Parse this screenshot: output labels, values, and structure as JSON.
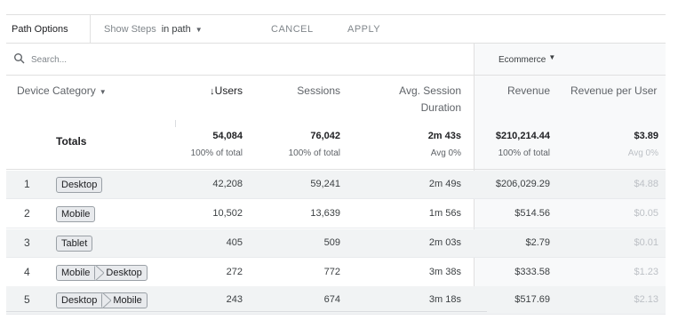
{
  "toolbar": {
    "path_options": "Path Options",
    "show_steps_label": "Show Steps",
    "show_steps_value": "in path",
    "cancel": "CANCEL",
    "apply": "APPLY"
  },
  "search": {
    "placeholder": "Search..."
  },
  "segment": {
    "label": "Ecommerce"
  },
  "columns": {
    "dimension": "Device Category",
    "users": "Users",
    "sessions": "Sessions",
    "duration_l1": "Avg. Session",
    "duration_l2": "Duration",
    "revenue": "Revenue",
    "rpu": "Revenue per User"
  },
  "totals": {
    "label": "Totals",
    "users": "54,084",
    "users_sub": "100% of total",
    "sessions": "76,042",
    "sessions_sub": "100% of total",
    "duration": "2m 43s",
    "duration_sub": "Avg 0%",
    "revenue": "$210,214.44",
    "revenue_sub": "100% of total",
    "rpu": "$3.89",
    "rpu_sub": "Avg 0%"
  },
  "rows": [
    {
      "num": "1",
      "chips": [
        "Desktop"
      ],
      "users": "42,208",
      "sessions": "59,241",
      "duration": "2m 49s",
      "revenue": "$206,029.29",
      "rpu": "$4.88"
    },
    {
      "num": "2",
      "chips": [
        "Mobile"
      ],
      "users": "10,502",
      "sessions": "13,639",
      "duration": "1m 56s",
      "revenue": "$514.56",
      "rpu": "$0.05"
    },
    {
      "num": "3",
      "chips": [
        "Tablet"
      ],
      "users": "405",
      "sessions": "509",
      "duration": "2m 03s",
      "revenue": "$2.79",
      "rpu": "$0.01"
    },
    {
      "num": "4",
      "chips": [
        "Mobile",
        "Desktop"
      ],
      "users": "272",
      "sessions": "772",
      "duration": "3m 38s",
      "revenue": "$333.58",
      "rpu": "$1.23"
    },
    {
      "num": "5",
      "chips": [
        "Desktop",
        "Mobile"
      ],
      "users": "243",
      "sessions": "674",
      "duration": "3m 18s",
      "revenue": "$517.69",
      "rpu": "$2.13"
    }
  ],
  "icons": {
    "search": "search-icon",
    "sort_down": "arrow-down-icon",
    "dropdown": "caret-down-icon"
  }
}
